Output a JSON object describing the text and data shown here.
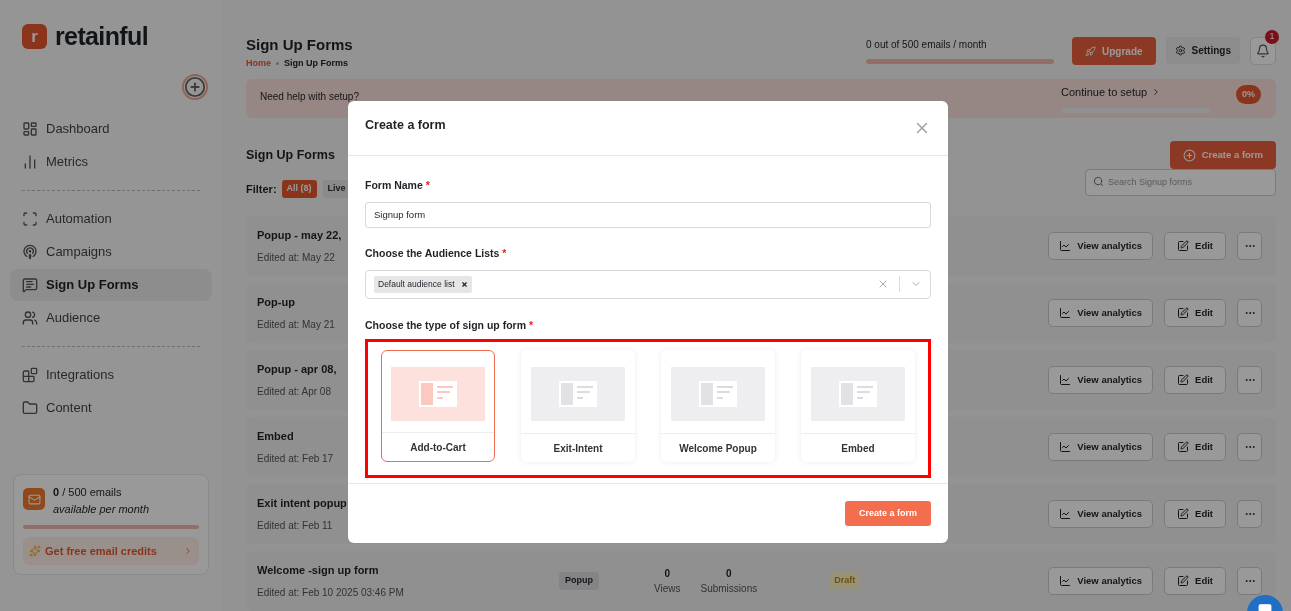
{
  "sidebar": {
    "logo_mark": "r",
    "logo": "retainful",
    "groups": [
      {
        "items": [
          {
            "label": "Dashboard",
            "selected": false
          },
          {
            "label": "Metrics",
            "selected": false
          }
        ]
      },
      {
        "items": [
          {
            "label": "Automation",
            "selected": false
          },
          {
            "label": "Campaigns",
            "selected": false
          },
          {
            "label": "Sign Up Forms",
            "selected": true
          },
          {
            "label": "Audience",
            "selected": false
          }
        ]
      },
      {
        "items": [
          {
            "label": "Integrations",
            "selected": false
          },
          {
            "label": "Content",
            "selected": false
          }
        ]
      }
    ],
    "credits": {
      "count": "0",
      "total": " / 500 emails",
      "note": "available per month",
      "link": "Get free email credits"
    }
  },
  "header": {
    "title": "Sign Up Forms",
    "breadcrumb": [
      {
        "label": "Home",
        "selected": false
      },
      {
        "label": "Sign Up Forms",
        "selected": true
      }
    ],
    "usage": "0 out of 500 emails / month",
    "upgrade": "Upgrade",
    "settings": "Settings",
    "notifications": "1"
  },
  "banner": {
    "text": "Need help with setup?",
    "continue": "Continue to setup",
    "progress": "0%"
  },
  "section": {
    "title": "Sign Up Forms",
    "create": "Create a form",
    "filter_label": "Filter:",
    "filters": [
      {
        "label": "All (8)",
        "selected": true
      },
      {
        "label": "Live",
        "selected": false
      }
    ],
    "search": {
      "placeholder": "Search Signup forms"
    }
  },
  "rows": [
    {
      "name": "Popup - may 22,",
      "edited": "Edited at: May 22",
      "analytics": "View analytics",
      "edit": "Edit"
    },
    {
      "name": "Pop-up",
      "edited": "Edited at: May 21",
      "analytics": "View analytics",
      "edit": "Edit"
    },
    {
      "name": "Popup - apr 08,",
      "edited": "Edited at: Apr 08",
      "analytics": "View analytics",
      "edit": "Edit"
    },
    {
      "name": "Embed",
      "edited": "Edited at: Feb 17",
      "analytics": "View analytics",
      "edit": "Edit"
    },
    {
      "name": "Exit intent popup",
      "edited": "Edited at: Feb 11",
      "analytics": "View analytics",
      "edit": "Edit"
    },
    {
      "name": "Welcome -sign up form",
      "edited": "Edited at: Feb 10 2025 03:46 PM",
      "type": "Popup",
      "views": "0",
      "views_label": "Views",
      "submissions": "0",
      "submissions_label": "Submissions",
      "status": "Draft",
      "analytics": "View analytics",
      "edit": "Edit"
    }
  ],
  "modal": {
    "title": "Create a form",
    "name_label": "Form Name",
    "name_value": "Signup form",
    "lists_label": "Choose the Audience Lists",
    "lists": [
      "Default audience list"
    ],
    "type_label": "Choose the type of sign up form",
    "required": "*",
    "types": [
      {
        "label": "Add-to-Cart",
        "selected": true
      },
      {
        "label": "Exit-Intent",
        "selected": false
      },
      {
        "label": "Welcome Popup",
        "selected": false
      },
      {
        "label": "Embed",
        "selected": false
      }
    ],
    "submit": "Create a form"
  }
}
